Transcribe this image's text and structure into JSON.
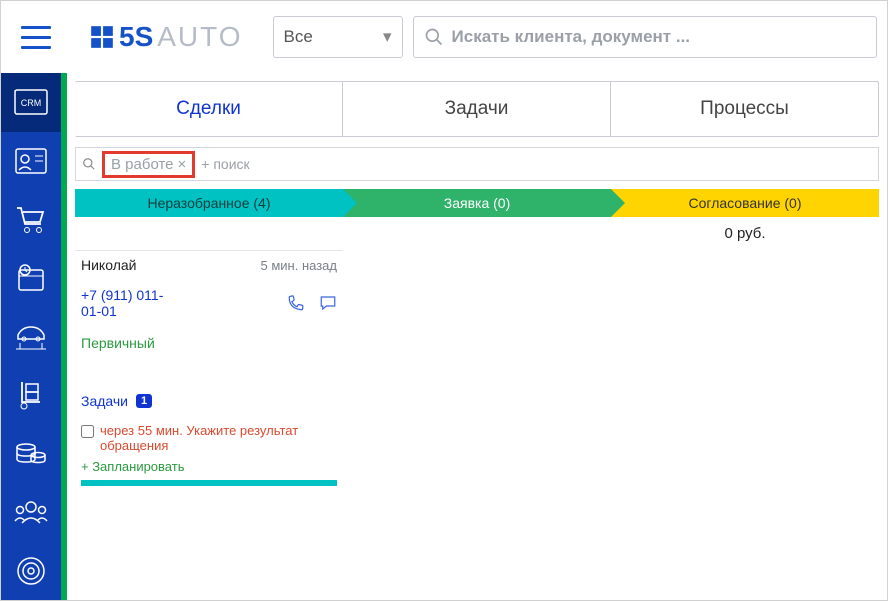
{
  "header": {
    "logo_bold": "5S",
    "logo_light": "AUTO",
    "select_value": "Все",
    "search_placeholder": "Искать клиента, документ ..."
  },
  "tabs": {
    "deals": "Сделки",
    "tasks": "Задачи",
    "processes": "Процессы"
  },
  "filter": {
    "chip": "В работе",
    "plus": "+ поиск"
  },
  "stages": {
    "s1": "Неразобранное (4)",
    "s2": "Заявка (0)",
    "s3": "Согласование (0)"
  },
  "amounts": {
    "c3": "0 руб."
  },
  "card": {
    "name": "Николай",
    "time": "5 мин. назад",
    "phone": "+7 (911) 011-01-01",
    "tag": "Первичный",
    "tasks_label": "Задачи",
    "tasks_count": "1",
    "task_text": "через 55 мин. Укажите результат обращения",
    "plan": "+ Запланировать"
  }
}
